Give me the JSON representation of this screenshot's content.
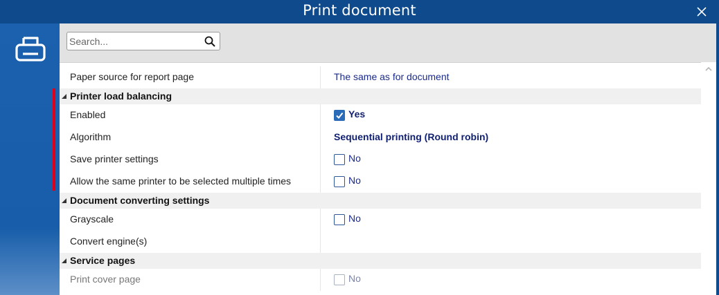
{
  "window": {
    "title": "Print document"
  },
  "search": {
    "placeholder": "Search...",
    "value": ""
  },
  "rows": [
    {
      "kind": "row",
      "label": "Paper source for report page",
      "value": "The same as for document"
    },
    {
      "kind": "group",
      "title": "Printer load balancing"
    },
    {
      "kind": "checkbox",
      "label": "Enabled",
      "checked": true,
      "value": "Yes"
    },
    {
      "kind": "row",
      "label": "Algorithm",
      "value": "Sequential printing (Round robin)"
    },
    {
      "kind": "checkbox",
      "label": "Save printer settings",
      "checked": false,
      "value": "No"
    },
    {
      "kind": "checkbox",
      "label": "Allow the same printer to be selected multiple times",
      "checked": false,
      "value": "No"
    },
    {
      "kind": "group",
      "title": "Document converting settings"
    },
    {
      "kind": "checkbox",
      "label": "Grayscale",
      "checked": false,
      "value": "No"
    },
    {
      "kind": "row",
      "label": "Convert engine(s)",
      "value": ""
    },
    {
      "kind": "group",
      "title": "Service pages"
    },
    {
      "kind": "checkbox",
      "label": "Print cover page",
      "checked": false,
      "value": "No",
      "disabled": true
    }
  ],
  "colors": {
    "titlebar": "#0e4a8c",
    "sidebar": "#1b61ad",
    "accent": "#2b6cb8",
    "marker": "#e0001a",
    "value_text": "#1a2a8a"
  },
  "icons": {
    "close": "close-icon",
    "printer": "printer-icon",
    "search": "search-icon",
    "scroll_up": "scroll-up-icon"
  }
}
